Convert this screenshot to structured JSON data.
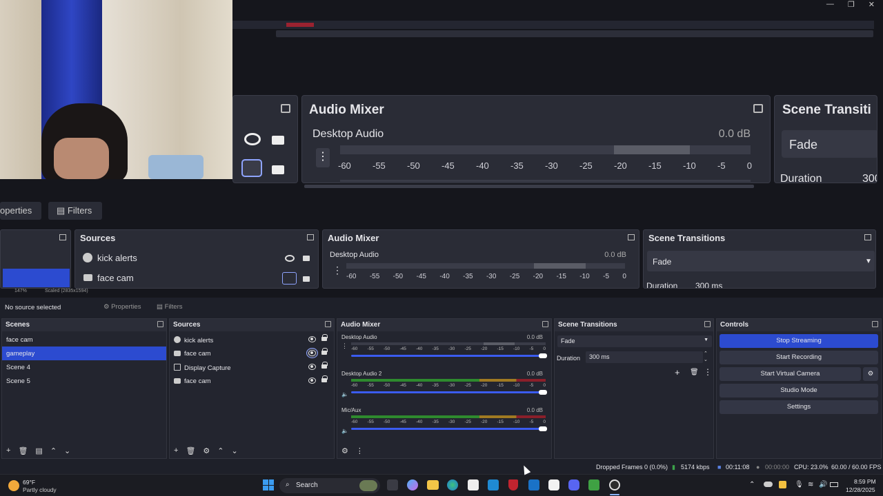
{
  "window_controls": [
    "—",
    "❐",
    "✕"
  ],
  "preview_top": {
    "sources_panel_title": "",
    "audio_mixer_title": "Audio Mixer",
    "desktop_audio": "Desktop Audio",
    "desktop_db": "0.0 dB",
    "ticks": [
      "-60",
      "-55",
      "-50",
      "-45",
      "-40",
      "-35",
      "-30",
      "-25",
      "-20",
      "-15",
      "-10",
      "-5",
      "0"
    ],
    "scene_transitions_title": "Scene Transiti",
    "fade": "Fade",
    "duration": "Duration",
    "duration_value": "300"
  },
  "preview_mid": {
    "tab_properties": "operties",
    "tab_filters": "Filters",
    "sources_title": "Sources",
    "sources": [
      "kick alerts",
      "face cam"
    ],
    "audio_mixer_title": "Audio Mixer",
    "desktop_audio": "Desktop Audio",
    "desktop_db": "0.0 dB",
    "ticks": [
      "-60",
      "-55",
      "-50",
      "-45",
      "-40",
      "-35",
      "-30",
      "-25",
      "-20",
      "-15",
      "-10",
      "-5",
      "0"
    ],
    "scene_transitions_title": "Scene Transitions",
    "fade": "Fade",
    "duration": "Duration",
    "duration_value": "300 ms",
    "zoom": "147%",
    "scaled": "Scaled (2835x1594)"
  },
  "context_bar": {
    "no_source": "No source selected",
    "properties": "Properties",
    "filters": "Filters"
  },
  "scenes": {
    "title": "Scenes",
    "items": [
      "face cam",
      "gameplay",
      "Scene 4",
      "Scene 5"
    ],
    "selected_index": 1
  },
  "sources": {
    "title": "Sources",
    "items": [
      {
        "label": "kick alerts",
        "icon": "browser-icon"
      },
      {
        "label": "face cam",
        "icon": "camera-icon"
      },
      {
        "label": "Display Capture",
        "icon": "monitor-icon"
      },
      {
        "label": "face cam",
        "icon": "camera-icon"
      }
    ]
  },
  "audio_mixer": {
    "title": "Audio Mixer",
    "channels": [
      {
        "name": "Desktop Audio",
        "db": "0.0 dB"
      },
      {
        "name": "Desktop Audio 2",
        "db": "0.0 dB"
      },
      {
        "name": "Mic/Aux",
        "db": "0.0 dB"
      }
    ],
    "ticks": [
      "-60",
      "-55",
      "-50",
      "-45",
      "-40",
      "-35",
      "-30",
      "-25",
      "-20",
      "-15",
      "-10",
      "-5",
      "0"
    ]
  },
  "scene_transitions": {
    "title": "Scene Transitions",
    "selected": "Fade",
    "duration_label": "Duration",
    "duration_value": "300 ms"
  },
  "controls": {
    "title": "Controls",
    "stop_streaming": "Stop Streaming",
    "start_recording": "Start Recording",
    "start_virtual_camera": "Start Virtual Camera",
    "studio_mode": "Studio Mode",
    "settings": "Settings"
  },
  "status": {
    "dropped_frames": "Dropped Frames 0 (0.0%)",
    "kbps": "5174 kbps",
    "stream_time": "00:11:08",
    "rec_time": "00:00:00",
    "cpu": "CPU: 23.0%",
    "fps": "60.00 / 60.00 FPS"
  },
  "taskbar": {
    "temp": "69°F",
    "weather": "Partly cloudy",
    "search": "Search",
    "time": "8:59 PM",
    "date": "12/28/2025"
  },
  "colors": {
    "accent": "#2c4bd0",
    "meter_green": "#2e8a2e",
    "meter_yellow": "#a07a22",
    "meter_red": "#8a1f2a"
  }
}
